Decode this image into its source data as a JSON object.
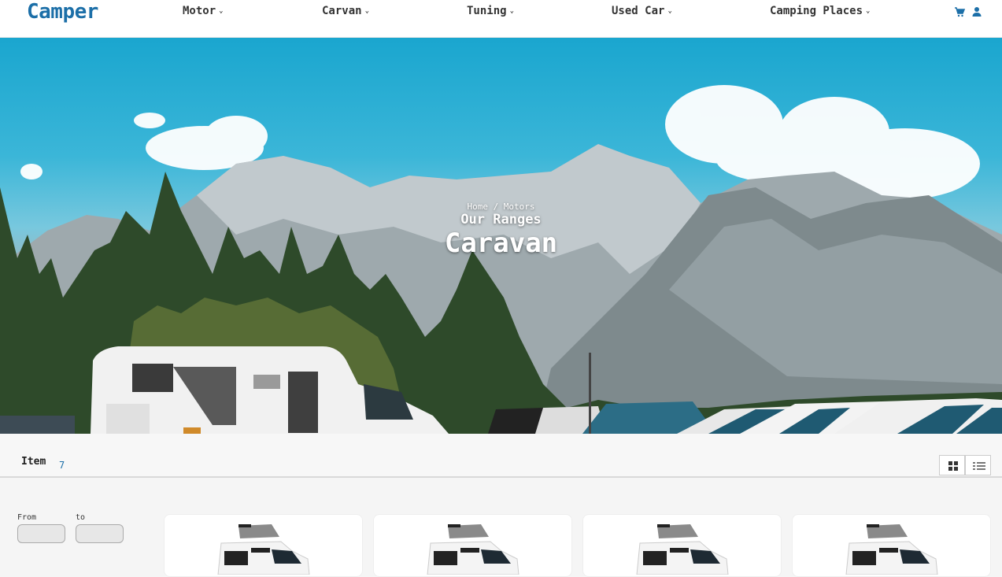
{
  "header": {
    "logo": "Camper",
    "nav": [
      {
        "label": "Motor"
      },
      {
        "label": "Carvan"
      },
      {
        "label": "Tuning"
      },
      {
        "label": "Used Car"
      },
      {
        "label": "Camping Places"
      }
    ],
    "icons": [
      "cart-icon",
      "user-icon"
    ]
  },
  "hero": {
    "breadcrumb": "Home / Motors",
    "subtitle": "Our Ranges",
    "title": "Caravan"
  },
  "toolbar": {
    "item_label": "Item",
    "item_count": "7",
    "views": [
      "grid-view-icon",
      "list-view-icon"
    ]
  },
  "filter": {
    "from_label": "From",
    "to_label": "to"
  },
  "cards": [
    {
      "image": "camper-van"
    },
    {
      "image": "camper-van"
    },
    {
      "image": "camper-van"
    },
    {
      "image": "camper-van"
    }
  ],
  "colors": {
    "brand": "#1c6fa8",
    "sky": "#1aa6cf"
  }
}
